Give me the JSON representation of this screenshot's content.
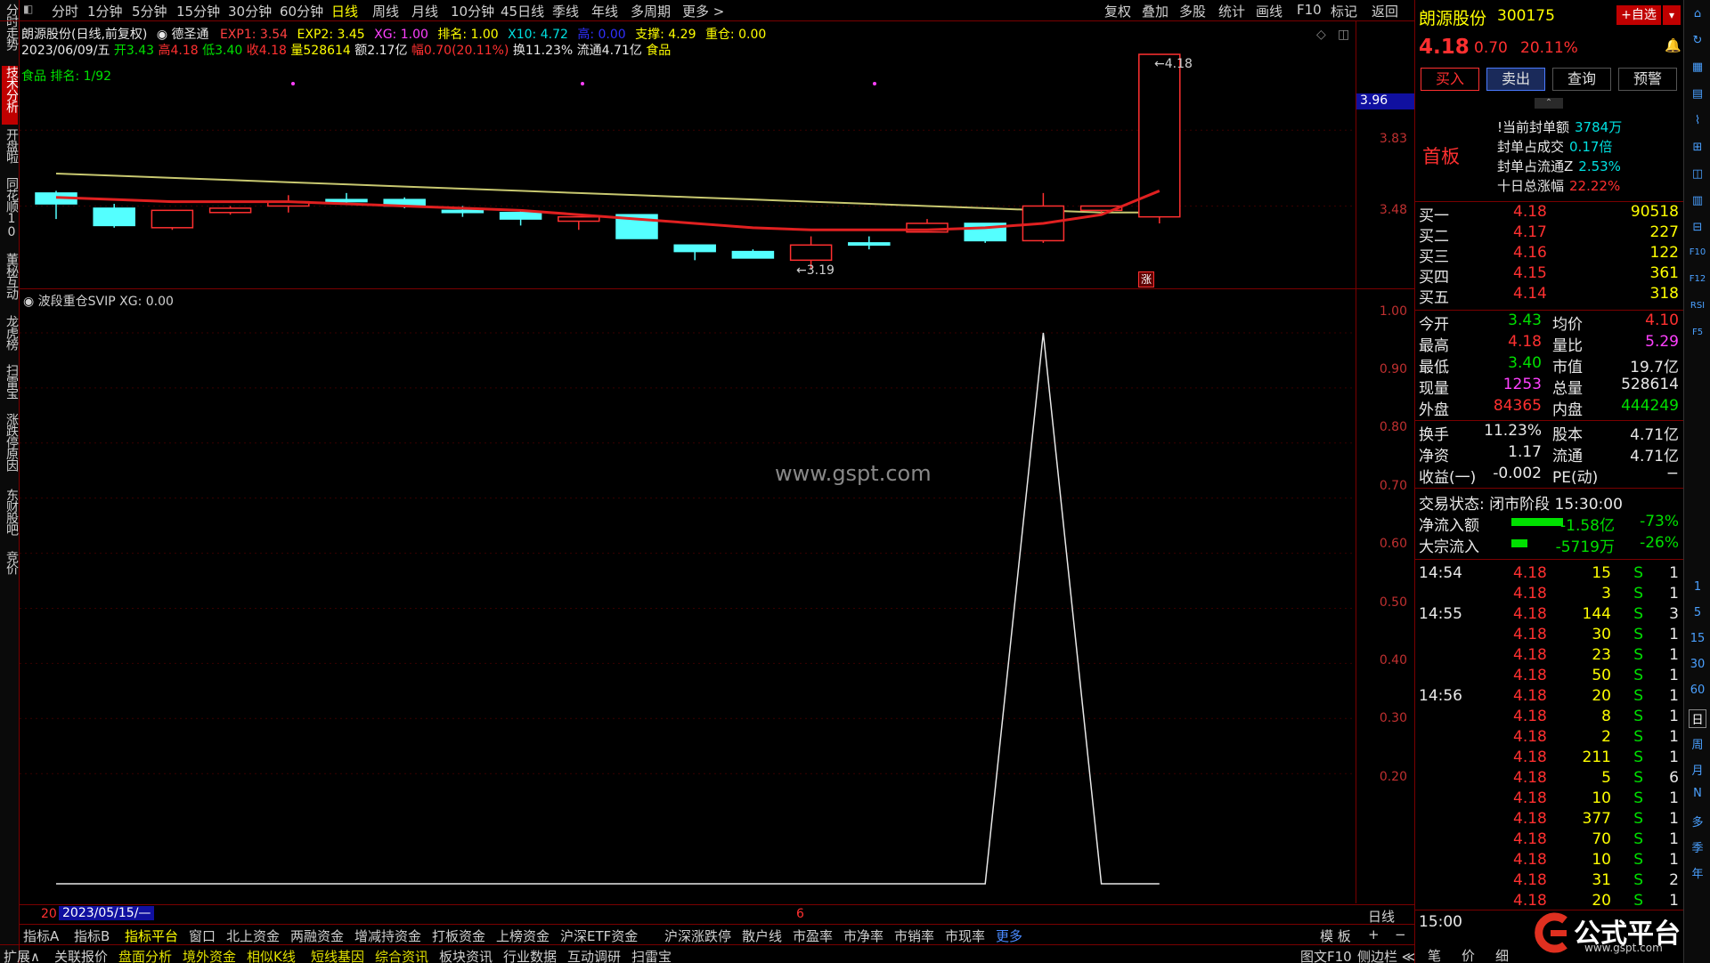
{
  "periods": [
    "分时",
    "1分钟",
    "5分钟",
    "15分钟",
    "30分钟",
    "60分钟",
    "日线",
    "周线",
    "月线",
    "10分钟",
    "45日线",
    "季线",
    "年线",
    "多周期",
    "更多 >"
  ],
  "active_period": "日线",
  "top_right_buttons": [
    "复权",
    "叠加",
    "多股",
    "统计",
    "画线",
    "F10",
    "标记",
    "返回"
  ],
  "left_tabs": [
    "分时走势",
    "技术分析",
    "开盘啦",
    "同花顺10",
    "董秘互动",
    "龙虎榜",
    "扫雷宝",
    "涨跌停原因",
    "东财股吧",
    "竞价"
  ],
  "info": {
    "name_line": "朗源股份(日线,前复权)",
    "indicator_name": "德圣通",
    "exp1": "EXP1: 3.54",
    "exp2": "EXP2: 3.45",
    "xg": "XG: 1.00",
    "rank": "排名: 1.00",
    "x10": "X10: 4.72",
    "hidden": "高: 0.00",
    "support": "支撑: 4.29",
    "position": "重仓: 0.00",
    "date": "2023/06/09/五",
    "open": "开3.43",
    "high": "高4.18",
    "low": "低3.40",
    "close": "收4.18",
    "volume": "量528614",
    "amount": "额2.17亿",
    "change": "幅0.70(20.11%)",
    "turnover": "换11.23%",
    "float": "流通4.71亿",
    "sector": "食品",
    "sector_rank": "食品 排名: 1/92"
  },
  "price_axis": [
    "3.83",
    "3.48"
  ],
  "price_marker": "3.96",
  "high_label": "4.18",
  "low_label": "3.19",
  "zhang_label": "涨",
  "watermark": "www.gspt.com",
  "indicator_title": "波段重仓SVIP XG: 0.00",
  "indicator_axis": [
    "1.00",
    "0.90",
    "0.80",
    "0.70",
    "0.60",
    "0.50",
    "0.40",
    "0.30",
    "0.20"
  ],
  "timebar": {
    "left_num": "20",
    "date": "2023/05/15/—",
    "mid": "6",
    "right": "日线"
  },
  "tabs1": [
    "指标A",
    "指标B",
    "指标平台",
    "窗口",
    "北上资金",
    "两融资金",
    "增减持资金",
    "打板资金",
    "上榜资金",
    "沪深ETF资金",
    "沪深涨跌停",
    "散户线",
    "市盈率",
    "市净率",
    "市销率",
    "市现率",
    "更多"
  ],
  "tabs1_right": [
    "模 板",
    "+",
    "−"
  ],
  "tabs2": [
    "扩展∧",
    "关联报价",
    "盘面分析",
    "境外资金",
    "相似K线",
    "短线基因",
    "综合资讯",
    "板块资讯",
    "行业数据",
    "互动调研",
    "扫雷宝"
  ],
  "tabs2_right": [
    "图文F10",
    "侧边栏 ≪"
  ],
  "stock": {
    "name": "朗源股份",
    "code": "300175",
    "add_label": "+自选",
    "price": "4.18",
    "change": "0.70",
    "pct": "20.11%",
    "buttons": [
      "买入",
      "卖出",
      "查询",
      "预警"
    ],
    "board_tag": "首板",
    "seal": [
      {
        "k": "!当前封单额",
        "v": "3784万"
      },
      {
        "k": "封单占成交",
        "v": "0.17倍"
      },
      {
        "k": "封单占流通Z",
        "v": "2.53%"
      },
      {
        "k": "十日总涨幅",
        "v": "22.22%"
      }
    ],
    "bids": [
      {
        "k": "买一",
        "p": "4.18",
        "v": "90518"
      },
      {
        "k": "买二",
        "p": "4.17",
        "v": "227"
      },
      {
        "k": "买三",
        "p": "4.16",
        "v": "122"
      },
      {
        "k": "买四",
        "p": "4.15",
        "v": "361"
      },
      {
        "k": "买五",
        "p": "4.14",
        "v": "318"
      }
    ],
    "stats": [
      {
        "k1": "今开",
        "v1": "3.43",
        "k2": "均价",
        "v2": "4.10"
      },
      {
        "k1": "最高",
        "v1": "4.18",
        "k2": "量比",
        "v2": "5.29"
      },
      {
        "k1": "最低",
        "v1": "3.40",
        "k2": "市值",
        "v2": "19.7亿"
      },
      {
        "k1": "现量",
        "v1": "1253",
        "k2": "总量",
        "v2": "528614"
      },
      {
        "k1": "外盘",
        "v1": "84365",
        "k2": "内盘",
        "v2": "444249"
      }
    ],
    "stats2": [
      {
        "k1": "换手",
        "v1": "11.23%",
        "k2": "股本",
        "v2": "4.71亿"
      },
      {
        "k1": "净资",
        "v1": "1.17",
        "k2": "流通",
        "v2": "4.71亿"
      },
      {
        "k1": "收益(一)",
        "v1": "-0.002",
        "k2": "PE(动)",
        "v2": "−"
      }
    ],
    "trade_state": "交易状态: 闭市阶段 15:30:00",
    "flows": [
      {
        "k": "净流入额",
        "v": "-1.58亿",
        "p": "-73%"
      },
      {
        "k": "大宗流入",
        "v": "-5719万",
        "p": "-26%"
      }
    ],
    "ticks": [
      {
        "t": "14:54",
        "p": "4.18",
        "v": "15",
        "s": "S",
        "n": "1"
      },
      {
        "t": "",
        "p": "4.18",
        "v": "3",
        "s": "S",
        "n": "1"
      },
      {
        "t": "14:55",
        "p": "4.18",
        "v": "144",
        "s": "S",
        "n": "3"
      },
      {
        "t": "",
        "p": "4.18",
        "v": "30",
        "s": "S",
        "n": "1"
      },
      {
        "t": "",
        "p": "4.18",
        "v": "23",
        "s": "S",
        "n": "1"
      },
      {
        "t": "",
        "p": "4.18",
        "v": "50",
        "s": "S",
        "n": "1"
      },
      {
        "t": "14:56",
        "p": "4.18",
        "v": "20",
        "s": "S",
        "n": "1"
      },
      {
        "t": "",
        "p": "4.18",
        "v": "8",
        "s": "S",
        "n": "1"
      },
      {
        "t": "",
        "p": "4.18",
        "v": "2",
        "s": "S",
        "n": "1"
      },
      {
        "t": "",
        "p": "4.18",
        "v": "211",
        "s": "S",
        "n": "1"
      },
      {
        "t": "",
        "p": "4.18",
        "v": "5",
        "s": "S",
        "n": "6"
      },
      {
        "t": "",
        "p": "4.18",
        "v": "10",
        "s": "S",
        "n": "1"
      },
      {
        "t": "",
        "p": "4.18",
        "v": "377",
        "s": "S",
        "n": "1"
      },
      {
        "t": "",
        "p": "4.18",
        "v": "70",
        "s": "S",
        "n": "1"
      },
      {
        "t": "",
        "p": "4.18",
        "v": "10",
        "s": "S",
        "n": "1"
      },
      {
        "t": "",
        "p": "4.18",
        "v": "31",
        "s": "S",
        "n": "2"
      },
      {
        "t": "",
        "p": "4.18",
        "v": "20",
        "s": "S",
        "n": "1"
      }
    ],
    "close_time": "15:00",
    "bottom_tabs": [
      "笔",
      "价",
      "细"
    ]
  },
  "brand": {
    "name": "公式平台",
    "url": "www.gspt.com"
  },
  "right_toolbar": [
    "1",
    "5",
    "15",
    "30",
    "60",
    "日",
    "周",
    "月",
    "N",
    "多",
    "季",
    "年"
  ],
  "right_toolbar_icons": [
    "F10",
    "F12",
    "RSI",
    "F5"
  ],
  "chart_data": {
    "type": "candlestick",
    "ylim": [
      3.1,
      4.25
    ],
    "candles": [
      {
        "o": 3.54,
        "c": 3.49,
        "h": 3.55,
        "l": 3.42
      },
      {
        "o": 3.47,
        "c": 3.39,
        "h": 3.49,
        "l": 3.38
      },
      {
        "o": 3.38,
        "c": 3.46,
        "h": 3.46,
        "l": 3.37
      },
      {
        "o": 3.45,
        "c": 3.47,
        "h": 3.48,
        "l": 3.44
      },
      {
        "o": 3.48,
        "c": 3.5,
        "h": 3.53,
        "l": 3.45
      },
      {
        "o": 3.51,
        "c": 3.5,
        "h": 3.54,
        "l": 3.49
      },
      {
        "o": 3.51,
        "c": 3.48,
        "h": 3.52,
        "l": 3.47
      },
      {
        "o": 3.46,
        "c": 3.45,
        "h": 3.48,
        "l": 3.43
      },
      {
        "o": 3.45,
        "c": 3.42,
        "h": 3.46,
        "l": 3.39
      },
      {
        "o": 3.41,
        "c": 3.43,
        "h": 3.43,
        "l": 3.37
      },
      {
        "o": 3.44,
        "c": 3.33,
        "h": 3.44,
        "l": 3.33
      },
      {
        "o": 3.3,
        "c": 3.27,
        "h": 3.3,
        "l": 3.23
      },
      {
        "o": 3.27,
        "c": 3.24,
        "h": 3.28,
        "l": 3.24
      },
      {
        "o": 3.23,
        "c": 3.3,
        "h": 3.34,
        "l": 3.19
      },
      {
        "o": 3.31,
        "c": 3.3,
        "h": 3.34,
        "l": 3.28
      },
      {
        "o": 3.36,
        "c": 3.4,
        "h": 3.42,
        "l": 3.36
      },
      {
        "o": 3.4,
        "c": 3.32,
        "h": 3.4,
        "l": 3.31
      },
      {
        "o": 3.32,
        "c": 3.48,
        "h": 3.54,
        "l": 3.31
      },
      {
        "o": 3.46,
        "c": 3.48,
        "h": 3.48,
        "l": 3.45
      },
      {
        "o": 3.43,
        "c": 4.18,
        "h": 4.18,
        "l": 3.4
      }
    ],
    "red_ma": [
      3.52,
      3.51,
      3.5,
      3.5,
      3.5,
      3.49,
      3.48,
      3.47,
      3.46,
      3.44,
      3.42,
      3.4,
      3.38,
      3.37,
      3.37,
      3.37,
      3.38,
      3.4,
      3.44,
      3.55
    ],
    "yellow_ma": [
      3.63,
      3.62,
      3.61,
      3.6,
      3.59,
      3.58,
      3.57,
      3.56,
      3.55,
      3.54,
      3.53,
      3.52,
      3.51,
      3.5,
      3.49,
      3.48,
      3.47,
      3.46,
      3.45,
      3.45
    ],
    "indicator": {
      "ylim": [
        0,
        1.05
      ],
      "values": [
        0,
        0,
        0,
        0,
        0,
        0,
        0,
        0,
        0,
        0,
        0,
        0,
        0,
        0,
        0,
        0,
        0,
        1,
        0,
        0
      ]
    }
  }
}
